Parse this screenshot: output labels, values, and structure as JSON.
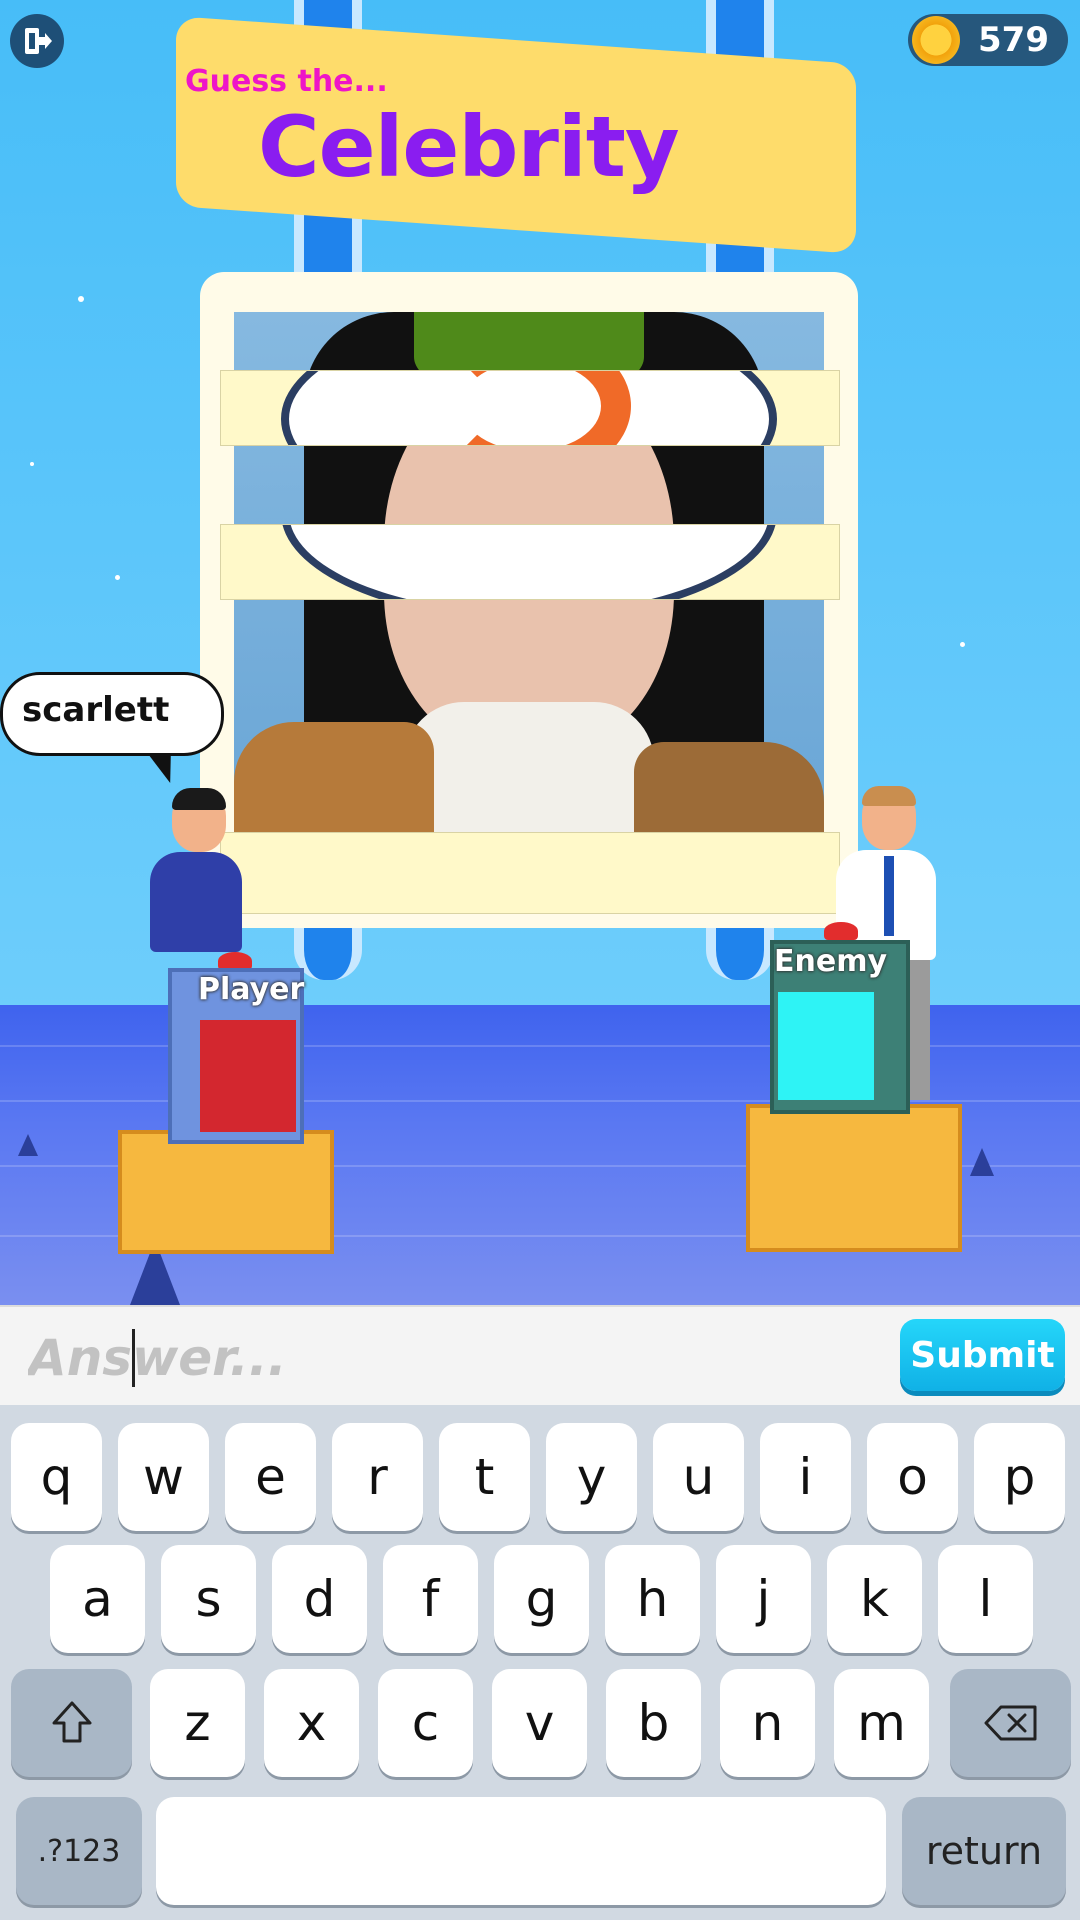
{
  "hud": {
    "exit_icon": "exit-door-icon",
    "coin_icon": "coin-icon",
    "coins": "579"
  },
  "title": {
    "small": "Guess the...",
    "big": "Celebrity"
  },
  "speech_bubble": "scarlett",
  "podiums": {
    "player_label": "Player",
    "enemy_label": "Enemy"
  },
  "input": {
    "placeholder": "Answer...",
    "submit_label": "Submit"
  },
  "keyboard": {
    "row1": [
      "q",
      "w",
      "e",
      "r",
      "t",
      "y",
      "u",
      "i",
      "o",
      "p"
    ],
    "row2": [
      "a",
      "s",
      "d",
      "f",
      "g",
      "h",
      "j",
      "k",
      "l"
    ],
    "row3": [
      "z",
      "x",
      "c",
      "v",
      "b",
      "n",
      "m"
    ],
    "shift_icon": "shift-arrow-icon",
    "backspace_icon": "backspace-icon",
    "numbers_label": ".?123",
    "return_label": "return"
  },
  "colors": {
    "title_small": "#ee15c8",
    "title_big": "#8a1df0",
    "player_screen": "#d3272f",
    "enemy_screen": "#2ef3f5",
    "submit": "#18c4f2"
  }
}
